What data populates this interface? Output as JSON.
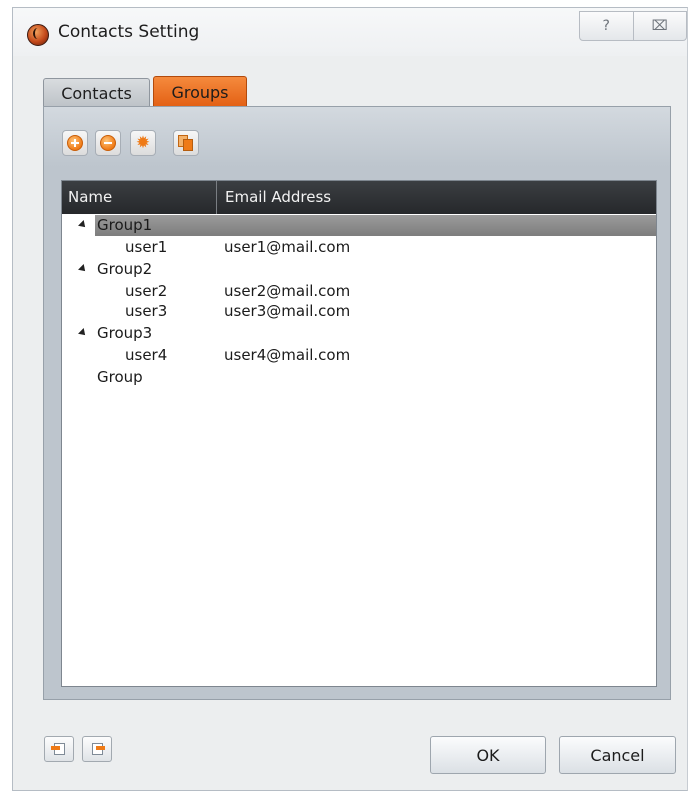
{
  "window": {
    "title": "Contacts Setting",
    "help_glyph": "?",
    "close_glyph": "⌧"
  },
  "tabs": [
    {
      "label": "Contacts",
      "active": false
    },
    {
      "label": "Groups",
      "active": true
    }
  ],
  "toolbar": {
    "icons": [
      "add-icon",
      "remove-icon",
      "settings-icon",
      "copy-icon"
    ]
  },
  "table": {
    "headers": {
      "name": "Name",
      "email": "Email Address"
    },
    "rows": [
      {
        "type": "group",
        "name": "Group1",
        "expanded": true,
        "selected": true
      },
      {
        "type": "user",
        "name": "user1",
        "email": "user1@mail.com"
      },
      {
        "type": "group",
        "name": "Group2",
        "expanded": true
      },
      {
        "type": "user",
        "name": "user2",
        "email": "user2@mail.com"
      },
      {
        "type": "user",
        "name": "user3",
        "email": "user3@mail.com"
      },
      {
        "type": "group",
        "name": "Group3",
        "expanded": true
      },
      {
        "type": "user",
        "name": "user4",
        "email": "user4@mail.com"
      },
      {
        "type": "group",
        "name": "Group",
        "expanded": false
      }
    ]
  },
  "buttons": {
    "ok": "OK",
    "cancel": "Cancel",
    "import_icon": "import-icon",
    "export_icon": "export-icon"
  },
  "colors": {
    "accent": "#ef7a16",
    "header_bg": "#2e3134",
    "selection": "#8a8a8a"
  }
}
